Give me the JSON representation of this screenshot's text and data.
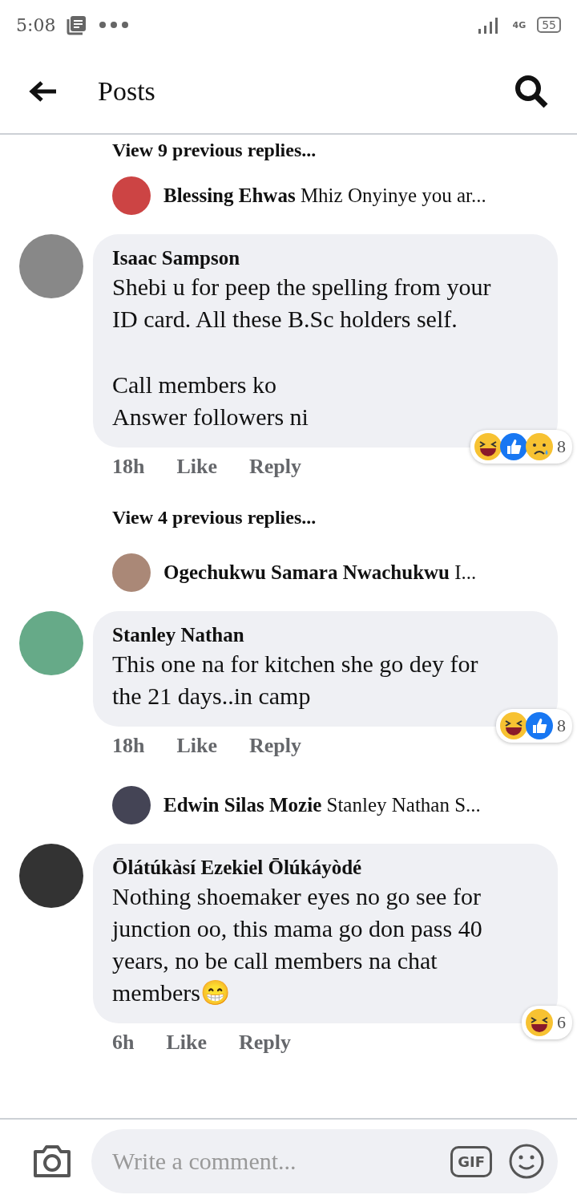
{
  "status_bar": {
    "time": "5:08",
    "network": "4G",
    "battery": "55"
  },
  "header": {
    "title": "Posts"
  },
  "thread": [
    {
      "kind": "view_more",
      "text": "View 9 previous replies..."
    },
    {
      "kind": "reply_preview",
      "name": "Blessing Ehwas",
      "snippet": "Mhiz Onyinye you ar..."
    },
    {
      "kind": "comment",
      "name": "Isaac Sampson",
      "paragraphs": [
        "Shebi u for peep the spelling from your ID card. All these B.Sc holders self.",
        "Call members ko\nAnswer followers ni"
      ],
      "time": "18h",
      "actions": [
        "Like",
        "Reply"
      ],
      "reactions": [
        {
          "kind": "haha"
        },
        {
          "kind": "like"
        },
        {
          "kind": "sad"
        }
      ],
      "count": "8"
    },
    {
      "kind": "view_more",
      "text": "View 4 previous replies..."
    },
    {
      "kind": "reply_preview",
      "name": "Ogechukwu Samara Nwachukwu",
      "snippet": "I..."
    },
    {
      "kind": "comment",
      "name": "Stanley Nathan",
      "paragraphs": [
        "This one na for kitchen she go dey for the 21 days..in camp"
      ],
      "time": "18h",
      "actions": [
        "Like",
        "Reply"
      ],
      "reactions": [
        {
          "kind": "haha"
        },
        {
          "kind": "like"
        }
      ],
      "count": "8"
    },
    {
      "kind": "reply_preview",
      "name": "Edwin Silas Mozie",
      "snippet": "Stanley Nathan S..."
    },
    {
      "kind": "comment",
      "name": "Ōlátúkàsí Ezekiel Ōlúkáyòdé",
      "paragraphs": [
        "Nothing shoemaker eyes no go see for junction oo, this mama go don pass 40 years, no be call members na chat members😁"
      ],
      "time": "6h",
      "actions": [
        "Like",
        "Reply"
      ],
      "reactions": [
        {
          "kind": "haha"
        }
      ],
      "count": "6"
    }
  ],
  "composer": {
    "placeholder": "Write a comment...",
    "gif": "GIF"
  }
}
